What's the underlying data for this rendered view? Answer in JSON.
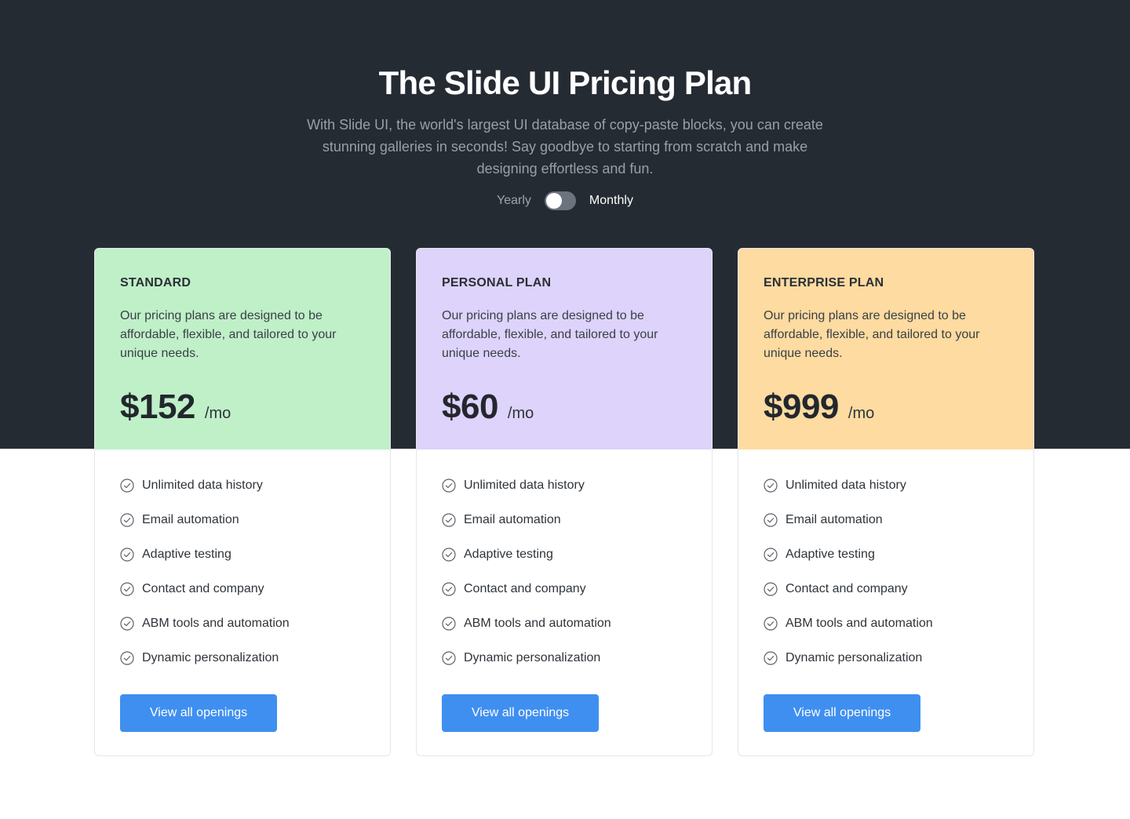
{
  "header": {
    "title": "The Slide UI Pricing Plan",
    "subtitle": "With Slide UI, the world's largest UI database of copy-paste blocks, you can create stunning galleries in seconds! Say goodbye to starting from scratch and make designing effortless and fun."
  },
  "billing_toggle": {
    "left_label": "Yearly",
    "right_label": "Monthly",
    "selected": "Yearly"
  },
  "colors": {
    "hero_bg": "#252b33",
    "standard": "#bff0c8",
    "personal": "#ddd3fb",
    "enterprise": "#fddba1",
    "button": "#3f8ff0"
  },
  "plans": [
    {
      "name": "STANDARD",
      "description": "Our pricing plans are designed to be affordable, flexible, and tailored to your unique needs.",
      "price": "$152",
      "period": "/mo",
      "features": [
        "Unlimited data history",
        "Email automation",
        "Adaptive testing",
        "Contact and company",
        "ABM tools and automation",
        "Dynamic personalization"
      ],
      "cta": "View all openings"
    },
    {
      "name": "PERSONAL PLAN",
      "description": "Our pricing plans are designed to be affordable, flexible, and tailored to your unique needs.",
      "price": "$60",
      "period": "/mo",
      "features": [
        "Unlimited data history",
        "Email automation",
        "Adaptive testing",
        "Contact and company",
        "ABM tools and automation",
        "Dynamic personalization"
      ],
      "cta": "View all openings"
    },
    {
      "name": "ENTERPRISE PLAN",
      "description": "Our pricing plans are designed to be affordable, flexible, and tailored to your unique needs.",
      "price": "$999",
      "period": "/mo",
      "features": [
        "Unlimited data history",
        "Email automation",
        "Adaptive testing",
        "Contact and company",
        "ABM tools and automation",
        "Dynamic personalization"
      ],
      "cta": "View all openings"
    }
  ],
  "icons": {
    "feature": "check-circle-icon"
  }
}
